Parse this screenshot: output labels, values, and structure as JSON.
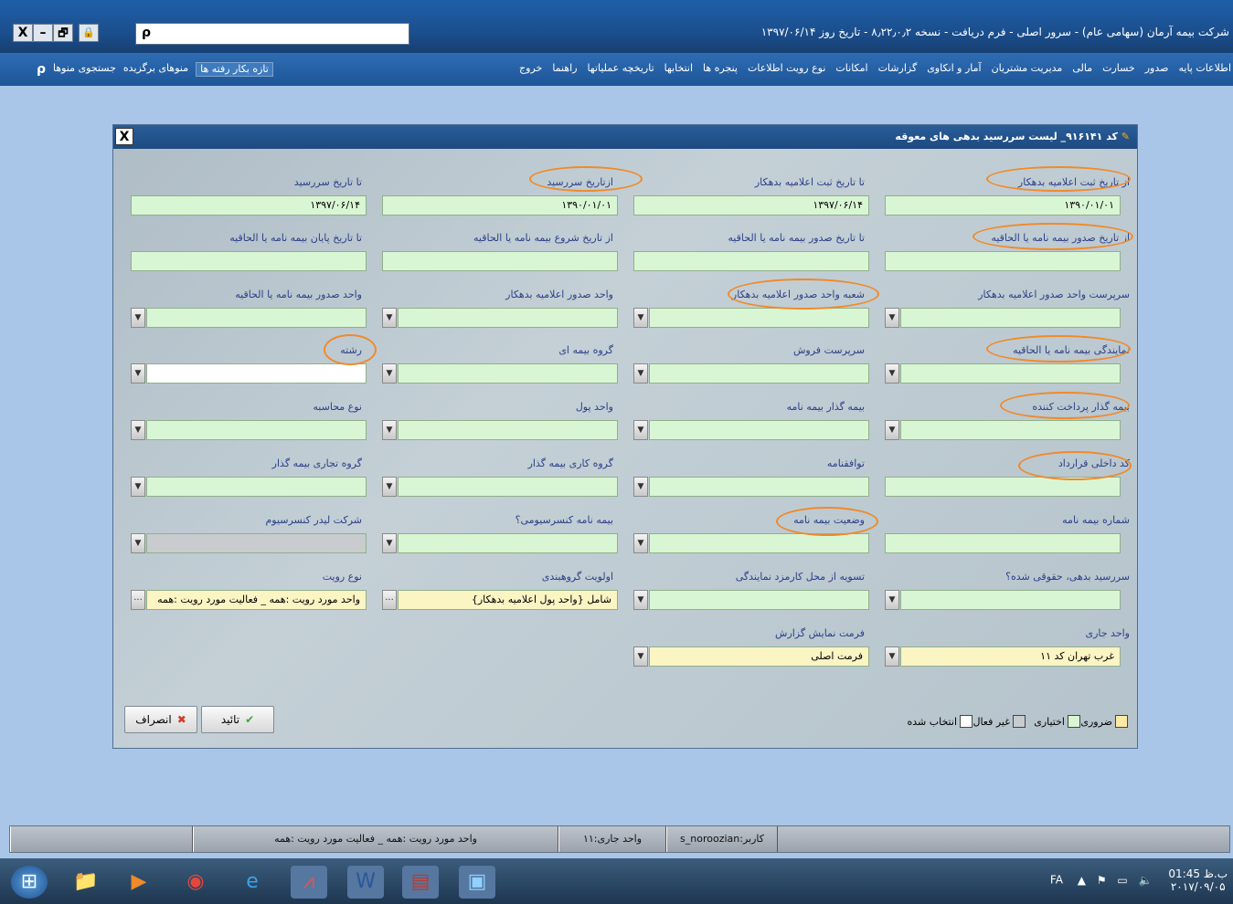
{
  "window": {
    "title": "شرکت بیمه آرمان (سهامی عام) - سرور اصلی - فرم دریافت - نسخه ۸٫۲۲٫۰٫۲ - تاریخ روز ۱۳۹۷/۰۶/۱۴",
    "close_glyph": "X",
    "minimize_glyph": "–",
    "restore_glyph": "🗗",
    "lock_glyph": "🔒"
  },
  "search": {
    "icon": "search-icon",
    "glyph": "ρ",
    "value": ""
  },
  "menu": {
    "items": [
      "اطلاعات پایه",
      "صدور",
      "خسارت",
      "مالی",
      "مدیریت مشتریان",
      "آمار و انکاوی",
      "گزارشات",
      "امکانات",
      "نوع رویت اطلاعات",
      "پنجره ها",
      "انتخابها",
      "تاریخچه عملیاتها",
      "راهنما",
      "خروج"
    ],
    "refresh_tabs": "تازه بکار رفته ها",
    "favorites": "منوهای برگزیده",
    "menu_search": "جستجوی منوها",
    "menu_search_glyph": "ρ"
  },
  "dialog": {
    "title": "کد ۹۱۶۱۴۱_ لیست سررسید بدهی های معوقه",
    "close": "X",
    "fields": {
      "from_debt_reg_date": {
        "label": "از تاریخ ثبت اعلامیه بدهکار",
        "value": "۱۳۹۰/۰۱/۰۱"
      },
      "to_debt_reg_date": {
        "label": "تا تاریخ ثبت اعلامیه بدهکار",
        "value": "۱۳۹۷/۰۶/۱۴"
      },
      "from_due_date": {
        "label": "ازتاریخ سررسید",
        "value": "۱۳۹۰/۰۱/۰۱"
      },
      "to_due_date": {
        "label": "تا تاریخ سررسید",
        "value": "۱۳۹۷/۰۶/۱۴"
      },
      "from_policy_issue": {
        "label": "از تاریخ صدور بیمه نامه یا الحاقیه",
        "value": ""
      },
      "to_policy_issue": {
        "label": "تا تاریخ صدور بیمه نامه یا الحاقیه",
        "value": ""
      },
      "from_policy_start": {
        "label": "از تاریخ شروع بیمه نامه یا الحاقیه",
        "value": ""
      },
      "to_policy_end": {
        "label": "تا تاریخ پایان بیمه نامه یا الحاقیه",
        "value": ""
      },
      "supervisor_unit": {
        "label": "سرپرست واحد صدور اعلامیه بدهکار",
        "value": ""
      },
      "branch_unit": {
        "label": "شعبه واحد صدور اعلامیه بدهکار",
        "value": ""
      },
      "issue_unit_debt": {
        "label": "واحد صدور اعلامیه بدهکار",
        "value": ""
      },
      "issue_unit_policy": {
        "label": "واحد صدور بیمه نامه یا الحاقیه",
        "value": ""
      },
      "agency": {
        "label": "نمایندگی بیمه نامه یا الحاقیه",
        "value": ""
      },
      "sales_supervisor": {
        "label": "سرپرست فروش",
        "value": ""
      },
      "insurance_group": {
        "label": "گروه بیمه ای",
        "value": ""
      },
      "field_line": {
        "label": "رشته",
        "value": ""
      },
      "payer_insurer": {
        "label": "بیمه گذار پرداخت کننده",
        "value": ""
      },
      "policy_insurer": {
        "label": "بیمه گذار بیمه نامه",
        "value": ""
      },
      "currency_unit": {
        "label": "واحد پول",
        "value": ""
      },
      "accounting_type": {
        "label": "نوع محاسبه",
        "value": ""
      },
      "contract_code": {
        "label": "کد داخلی قرارداد",
        "value": ""
      },
      "agreement": {
        "label": "توافقنامه",
        "value": ""
      },
      "work_group": {
        "label": "گروه کاری بیمه گذار",
        "value": ""
      },
      "business_group": {
        "label": "گروه تجاری بیمه گذار",
        "value": ""
      },
      "policy_number": {
        "label": "شماره بیمه نامه",
        "value": ""
      },
      "policy_status": {
        "label": "وضعیت بیمه نامه",
        "value": ""
      },
      "consortium_policy": {
        "label": "بیمه نامه کنسرسیومی؟",
        "value": ""
      },
      "consortium_leader": {
        "label": "شرکت لیدر کنسرسیوم",
        "value": ""
      },
      "legal_due": {
        "label": "سررسید بدهی، حقوقی شده؟",
        "value": ""
      },
      "settle_commission": {
        "label": "تسویه از محل کارمزد نمایندگی",
        "value": ""
      },
      "grouping_priority": {
        "label": "اولویت گروهبندی",
        "value": "شامل {واحد پول اعلامیه بدهکار}"
      },
      "view_type": {
        "label": "نوع رویت",
        "value": "واحد مورد رویت :همه _ فعالیت مورد رویت :همه"
      },
      "current_unit": {
        "label": "واحد جاری",
        "value": "غرب تهران کد ۱۱"
      },
      "report_format": {
        "label": "فرمت نمایش گزارش",
        "value": "فرمت اصلی"
      }
    },
    "dropdown_glyph": "▼",
    "ellipsis_glyph": "...",
    "confirm": "تائید",
    "confirm_icon": "✔",
    "cancel": "انصراف",
    "cancel_icon": "✖",
    "legend": [
      "ضروری",
      "اختیاری",
      "غیر فعال",
      "انتخاب شده"
    ],
    "legend_colors": [
      "#d9f6d4",
      "#d9f6d4",
      "#c8cccf",
      "#ffffff"
    ]
  },
  "statusbar": {
    "view": "واحد مورد رویت :همه _ فعالیت مورد رویت :همه",
    "current_unit": "واحد جاری:۱۱",
    "user": "کاربر:s_noroozian"
  },
  "taskbar": {
    "lang": "FA",
    "time": "01:45 ب.ظ",
    "date": "۲۰۱۷/۰۹/۰۵",
    "tray_up": "▲"
  }
}
